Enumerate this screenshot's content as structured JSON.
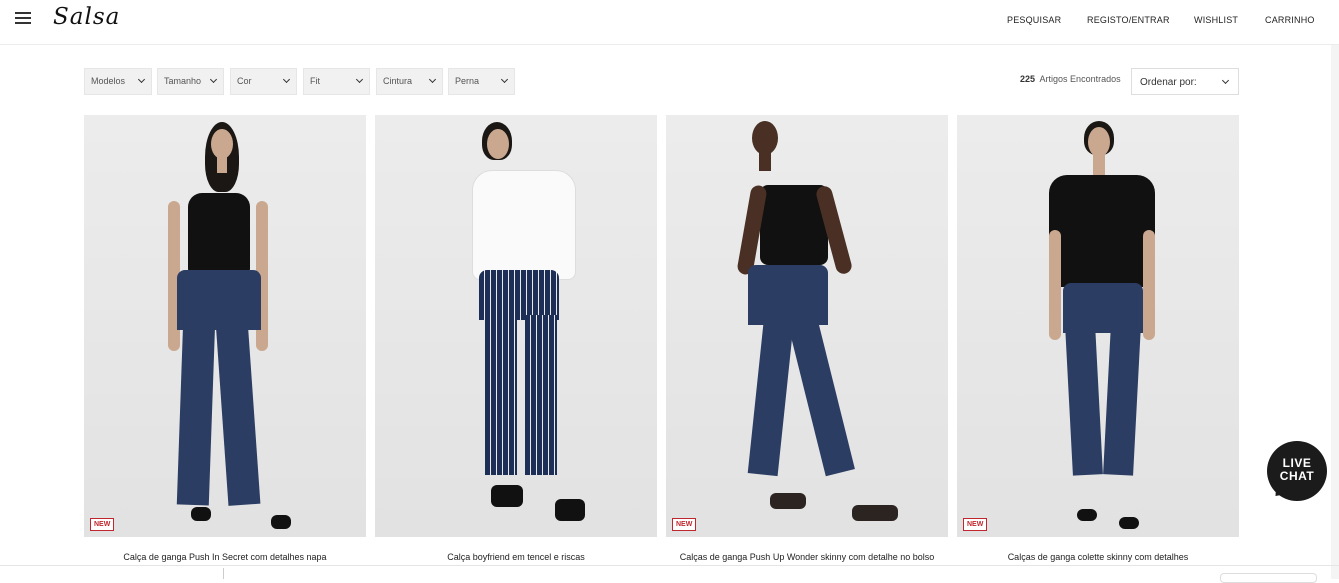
{
  "header": {
    "logo": "Salsa",
    "nav": [
      "PESQUISAR",
      "REGISTO/ENTRAR",
      "WISHLIST",
      "CARRINHO"
    ]
  },
  "filters": [
    "Modelos",
    "Tamanho",
    "Cor",
    "Fit",
    "Cintura",
    "Perna"
  ],
  "results": {
    "count": "225",
    "label": "Artigos Encontrados"
  },
  "sort": {
    "label": "Ordenar por:"
  },
  "products": [
    {
      "title": "Calça de ganga Push In Secret com detalhes napa",
      "badge": "NEW"
    },
    {
      "title": "Calça boyfriend em tencel e riscas",
      "badge": ""
    },
    {
      "title": "Calças de ganga Push Up Wonder skinny com detalhe no bolso",
      "badge": "NEW"
    },
    {
      "title": "Calças de ganga colette skinny com detalhes",
      "badge": "NEW"
    }
  ],
  "livechat": {
    "line1": "LIVE",
    "line2": "CHAT"
  },
  "colors": {
    "badge": "#c0262d",
    "denim": "#2c3d63",
    "dark": "#1b1b1b"
  },
  "icons": [
    "hamburger-menu-icon",
    "chevron-down-icon",
    "live-chat-icon"
  ]
}
